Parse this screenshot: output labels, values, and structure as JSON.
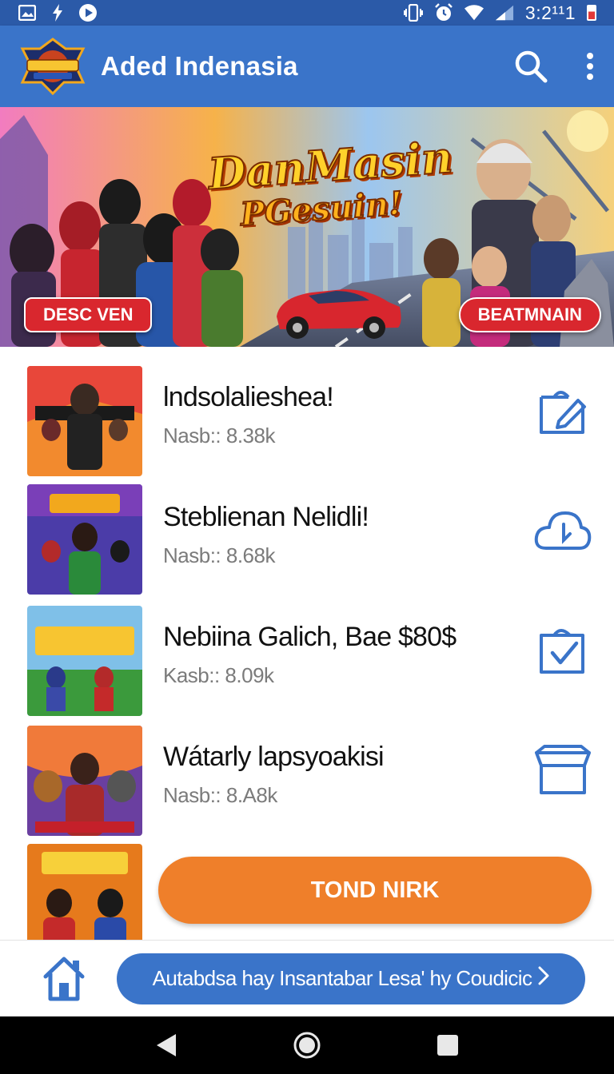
{
  "status_bar": {
    "time": "3:2¹¹1",
    "left_icons": [
      "gallery-icon",
      "bolt-icon",
      "play-icon"
    ],
    "right_icons": [
      "vibrate-icon",
      "alarm-icon",
      "wifi-icon",
      "signal-icon",
      "battery-icon"
    ]
  },
  "app_bar": {
    "title": "Aded Indenasia",
    "logo": "game-logo",
    "actions": [
      "search-icon",
      "more-vertical-icon"
    ]
  },
  "hero": {
    "title_line1": "DanMasin",
    "title_line2": "PGesuin!",
    "left_button": "DESC VEN",
    "right_button": "BEATMNAIN"
  },
  "list": {
    "items": [
      {
        "title": "lndsolalieshea!",
        "subtitle": "Nasb:: 8.38k",
        "action_icon": "edit-icon",
        "thumb_color": "#e8473a"
      },
      {
        "title": "Steblienan Nelidli!",
        "subtitle": "Nasb:: 8.68k",
        "action_icon": "cloud-download-icon",
        "thumb_color": "#4b3ca8"
      },
      {
        "title": "Nebiina Galich, Bae $80$",
        "subtitle": "Kasb:: 8.09k",
        "action_icon": "checkbox-icon",
        "thumb_color": "#3b9a3c"
      },
      {
        "title": "Wátarly lapsyoakisi",
        "subtitle": "Nasb:: 8.A8k",
        "action_icon": "box-icon",
        "thumb_color": "#6a3fa0"
      },
      {
        "title": "",
        "subtitle": "",
        "action_icon": "",
        "thumb_color": "#e67a1c"
      }
    ],
    "cta_label": "TOND NIRK"
  },
  "bottom_bar": {
    "home_icon": "home-icon",
    "promo_label": "Autabdsa hay Insantabar Lesa' hy Coudicic",
    "promo_icon": "chevron-right-icon"
  },
  "nav_bar": {
    "buttons": [
      "back-icon",
      "home-circle-icon",
      "recents-icon"
    ]
  },
  "colors": {
    "status_bar": "#2b5aa8",
    "app_bar": "#3a74c9",
    "accent_orange": "#ef7f2a",
    "hero_button_red": "#d9272e",
    "icon_blue": "#3a74c9"
  }
}
